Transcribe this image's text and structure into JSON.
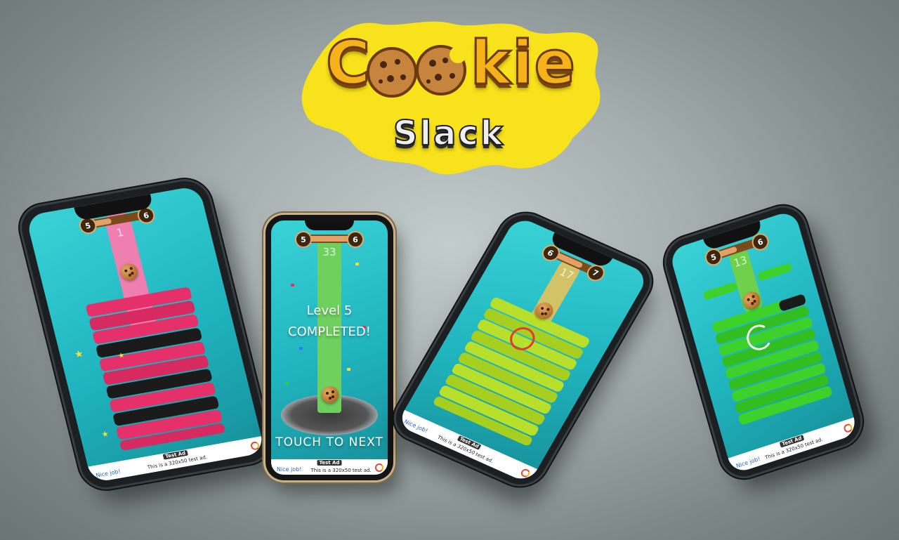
{
  "logo": {
    "word_start": "C",
    "word_end": "kie",
    "subtitle": "Slack",
    "colors": {
      "yellow": "#f8e21b",
      "gold": "#f6b21b",
      "brown": "#6b3b0f"
    }
  },
  "phones": [
    {
      "id": "phone-1",
      "level_left": "5",
      "level_right": "6",
      "score": "1",
      "tower_color": "#e5306a",
      "pole_color": "#ef7fb0",
      "ad": {
        "nice": "Nice job!",
        "tag": "Test Ad",
        "text": "This is a 320x50 test ad."
      }
    },
    {
      "id": "phone-2",
      "level_left": "5",
      "level_right": "6",
      "score": "33",
      "pole_color": "#6fcf5f",
      "message_line1": "Level 5",
      "message_line2": "COMPLETED!",
      "touch_label": "TOUCH TO NEXT",
      "ad": {
        "nice": "Nice job!",
        "tag": "Test Ad",
        "text": "This is a 320x50 test ad."
      }
    },
    {
      "id": "phone-3",
      "level_left": "6",
      "level_right": "7",
      "score": "17",
      "tower_color": "#b8e02a",
      "ad": {
        "nice": "Nice job!",
        "tag": "Test Ad",
        "text": "This is a 320x50 test ad."
      }
    },
    {
      "id": "phone-4",
      "level_left": "5",
      "level_right": "6",
      "score": "13",
      "tower_color": "#3ed12a",
      "ad": {
        "nice": "Nice job!",
        "tag": "Test Ad",
        "text": "This is a 320x50 test ad."
      }
    }
  ]
}
